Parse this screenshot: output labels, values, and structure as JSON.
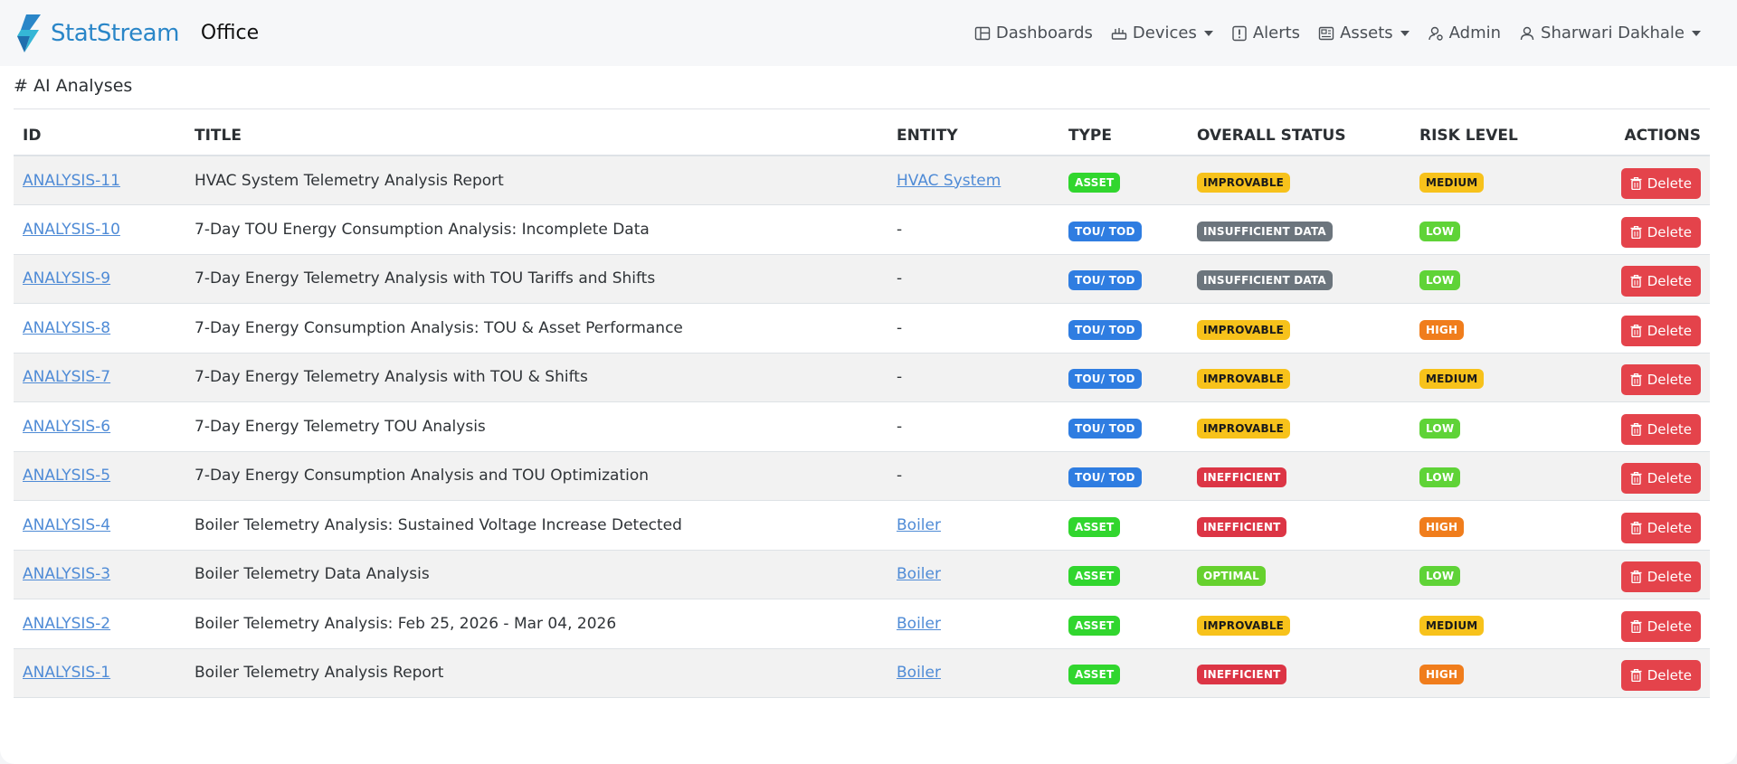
{
  "navbar": {
    "brand": "StatStream",
    "context": "Office",
    "items": [
      {
        "label": "Dashboards",
        "icon": "dashboard-icon",
        "dropdown": false
      },
      {
        "label": "Devices",
        "icon": "devices-icon",
        "dropdown": true
      },
      {
        "label": "Alerts",
        "icon": "alert-icon",
        "dropdown": false
      },
      {
        "label": "Assets",
        "icon": "assets-icon",
        "dropdown": true
      },
      {
        "label": "Admin",
        "icon": "admin-icon",
        "dropdown": false
      },
      {
        "label": "Sharwari Dakhale",
        "icon": "user-icon",
        "dropdown": true
      }
    ]
  },
  "page": {
    "heading": "# AI Analyses"
  },
  "table": {
    "columns": [
      "ID",
      "TITLE",
      "ENTITY",
      "TYPE",
      "OVERALL STATUS",
      "RISK LEVEL",
      "ACTIONS"
    ],
    "delete_label": "Delete",
    "rows": [
      {
        "id": "ANALYSIS-11",
        "title": "HVAC System Telemetry Analysis Report",
        "entity": "HVAC System",
        "entity_link": true,
        "type": "ASSET",
        "status": "IMPROVABLE",
        "risk": "MEDIUM"
      },
      {
        "id": "ANALYSIS-10",
        "title": "7-Day TOU Energy Consumption Analysis: Incomplete Data",
        "entity": "-",
        "entity_link": false,
        "type": "TOU/ TOD",
        "status": "INSUFFICIENT DATA",
        "risk": "LOW"
      },
      {
        "id": "ANALYSIS-9",
        "title": "7-Day Energy Telemetry Analysis with TOU Tariffs and Shifts",
        "entity": "-",
        "entity_link": false,
        "type": "TOU/ TOD",
        "status": "INSUFFICIENT DATA",
        "risk": "LOW"
      },
      {
        "id": "ANALYSIS-8",
        "title": "7-Day Energy Consumption Analysis: TOU & Asset Performance",
        "entity": "-",
        "entity_link": false,
        "type": "TOU/ TOD",
        "status": "IMPROVABLE",
        "risk": "HIGH"
      },
      {
        "id": "ANALYSIS-7",
        "title": "7-Day Energy Telemetry Analysis with TOU & Shifts",
        "entity": "-",
        "entity_link": false,
        "type": "TOU/ TOD",
        "status": "IMPROVABLE",
        "risk": "MEDIUM"
      },
      {
        "id": "ANALYSIS-6",
        "title": "7-Day Energy Telemetry TOU Analysis",
        "entity": "-",
        "entity_link": false,
        "type": "TOU/ TOD",
        "status": "IMPROVABLE",
        "risk": "LOW"
      },
      {
        "id": "ANALYSIS-5",
        "title": "7-Day Energy Consumption Analysis and TOU Optimization",
        "entity": "-",
        "entity_link": false,
        "type": "TOU/ TOD",
        "status": "INEFFICIENT",
        "risk": "LOW"
      },
      {
        "id": "ANALYSIS-4",
        "title": "Boiler Telemetry Analysis: Sustained Voltage Increase Detected",
        "entity": "Boiler",
        "entity_link": true,
        "type": "ASSET",
        "status": "INEFFICIENT",
        "risk": "HIGH"
      },
      {
        "id": "ANALYSIS-3",
        "title": "Boiler Telemetry Data Analysis",
        "entity": "Boiler",
        "entity_link": true,
        "type": "ASSET",
        "status": "OPTIMAL",
        "risk": "LOW"
      },
      {
        "id": "ANALYSIS-2",
        "title": "Boiler Telemetry Analysis: Feb 25, 2026 - Mar 04, 2026",
        "entity": "Boiler",
        "entity_link": true,
        "type": "ASSET",
        "status": "IMPROVABLE",
        "risk": "MEDIUM"
      },
      {
        "id": "ANALYSIS-1",
        "title": "Boiler Telemetry Analysis Report",
        "entity": "Boiler",
        "entity_link": true,
        "type": "ASSET",
        "status": "INEFFICIENT",
        "risk": "HIGH"
      }
    ]
  },
  "colors": {
    "brand": "#2a86c8",
    "link": "#4f8bd6",
    "delete": "#e4434b",
    "badges": {
      "ASSET": {
        "bg": "#31d62e",
        "fg": "#ffffff"
      },
      "TOU/ TOD": {
        "bg": "#2f7de1",
        "fg": "#ffffff"
      },
      "IMPROVABLE": {
        "bg": "#f7c21b",
        "fg": "#1a1a1a"
      },
      "INSUFFICIENT DATA": {
        "bg": "#6c757d",
        "fg": "#ffffff"
      },
      "INEFFICIENT": {
        "bg": "#dc3545",
        "fg": "#ffffff"
      },
      "OPTIMAL": {
        "bg": "#66d12e",
        "fg": "#ffffff"
      },
      "MEDIUM": {
        "bg": "#f7c21b",
        "fg": "#1a1a1a"
      },
      "LOW": {
        "bg": "#5fd337",
        "fg": "#ffffff"
      },
      "HIGH": {
        "bg": "#f07d1c",
        "fg": "#ffffff"
      }
    }
  }
}
